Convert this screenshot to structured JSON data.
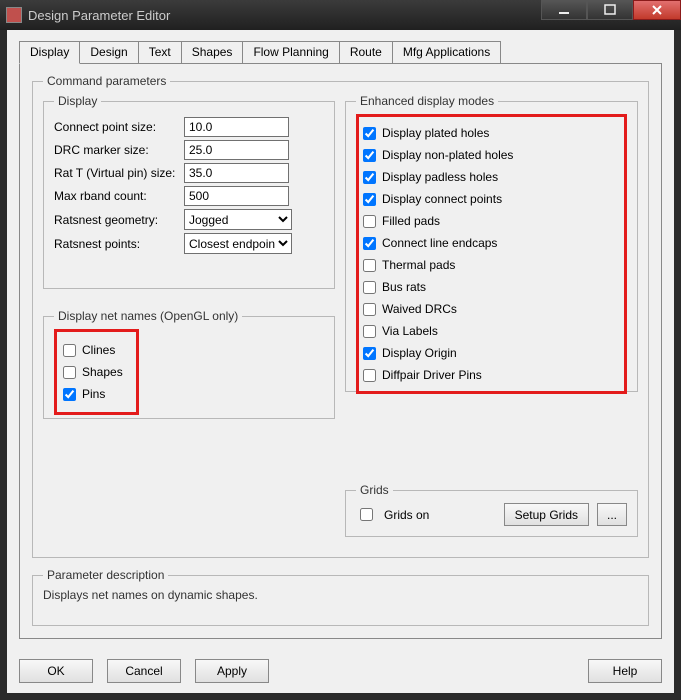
{
  "window": {
    "title": "Design Parameter Editor"
  },
  "tabs": {
    "items": [
      {
        "label": "Display"
      },
      {
        "label": "Design"
      },
      {
        "label": "Text"
      },
      {
        "label": "Shapes"
      },
      {
        "label": "Flow Planning"
      },
      {
        "label": "Route"
      },
      {
        "label": "Mfg Applications"
      }
    ]
  },
  "cmdparam_legend": "Command parameters",
  "display_group": {
    "legend": "Display",
    "connect_point_label": "Connect point size:",
    "connect_point_value": "10.0",
    "drc_marker_label": "DRC marker size:",
    "drc_marker_value": "25.0",
    "rat_t_label": "Rat T (Virtual pin) size:",
    "rat_t_value": "35.0",
    "max_rband_label": "Max rband count:",
    "max_rband_value": "500",
    "ratsnest_geom_label": "Ratsnest geometry:",
    "ratsnest_geom_value": "Jogged",
    "ratsnest_points_label": "Ratsnest points:",
    "ratsnest_points_value": "Closest endpoint"
  },
  "netnames_group": {
    "legend": "Display net names (OpenGL only)",
    "clines_label": "Clines",
    "clines_checked": false,
    "shapes_label": "Shapes",
    "shapes_checked": false,
    "pins_label": "Pins",
    "pins_checked": true
  },
  "enhanced_group": {
    "legend": "Enhanced display modes",
    "items": [
      {
        "label": "Display plated holes",
        "checked": true
      },
      {
        "label": "Display non-plated holes",
        "checked": true
      },
      {
        "label": "Display padless holes",
        "checked": true
      },
      {
        "label": "Display connect points",
        "checked": true
      },
      {
        "label": "Filled pads",
        "checked": false
      },
      {
        "label": "Connect line endcaps",
        "checked": true
      },
      {
        "label": "Thermal pads",
        "checked": false
      },
      {
        "label": "Bus rats",
        "checked": false
      },
      {
        "label": "Waived DRCs",
        "checked": false
      },
      {
        "label": "Via Labels",
        "checked": false
      },
      {
        "label": "Display Origin",
        "checked": true
      },
      {
        "label": "Diffpair Driver Pins",
        "checked": false
      }
    ]
  },
  "grids_group": {
    "legend": "Grids",
    "grids_on_label": "Grids on",
    "grids_on_checked": false,
    "setup_label": "Setup Grids",
    "ellipsis_label": "..."
  },
  "paramdesc": {
    "legend": "Parameter description",
    "text": "Displays net names on dynamic shapes."
  },
  "buttons": {
    "ok": "OK",
    "cancel": "Cancel",
    "apply": "Apply",
    "help": "Help"
  }
}
